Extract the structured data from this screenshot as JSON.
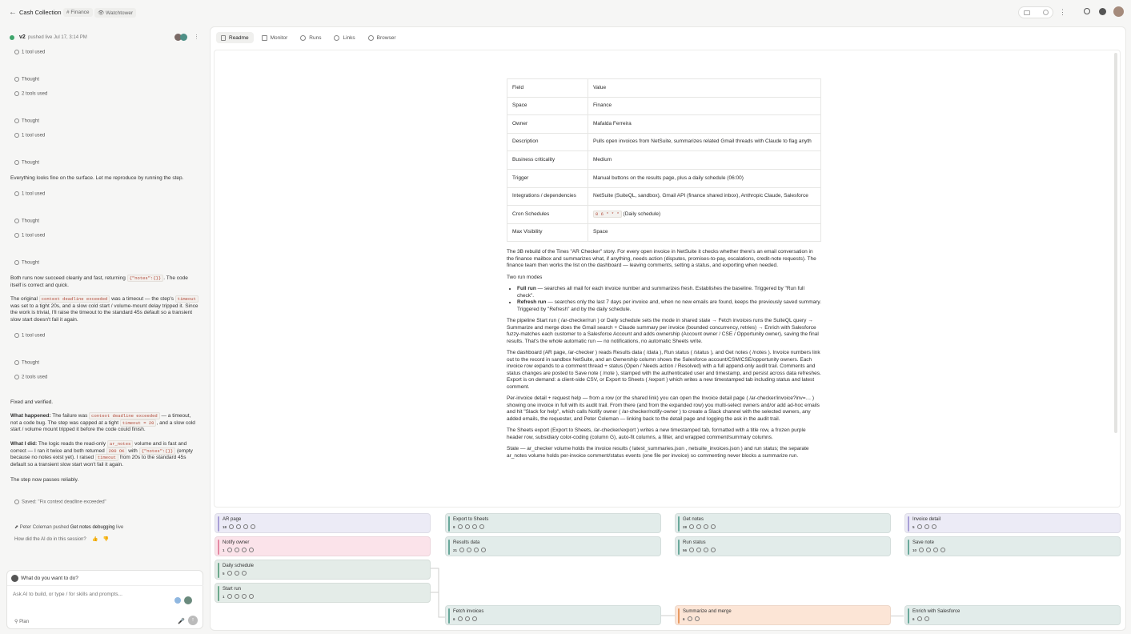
{
  "header": {
    "title": "Cash Collection",
    "tags": [
      "# Finance",
      "👁 Watchtower"
    ]
  },
  "version": {
    "label": "v2",
    "meta": "pushed live Jul 17, 3:14 PM"
  },
  "chat": {
    "tool1": "1 tool used",
    "thought1": "Thought",
    "tool2": "2 tools used",
    "thought2": "Thought",
    "tool3": "1 tool used",
    "thought3": "Thought",
    "msg1": "Everything looks fine on the surface. Let me reproduce by running the step.",
    "tool4": "1 tool used",
    "thought4": "Thought",
    "tool5": "1 tool used",
    "thought5": "Thought",
    "msg2a": "Both runs now succeed cleanly and fast, returning",
    "msg2code": "{\"notes\":{}}",
    "msg2b": ". The code itself is correct and quick.",
    "msg3a": "The original",
    "msg3code1": "context deadline exceeded",
    "msg3b": "was a timeout — the step's",
    "msg3code2": "timeout",
    "msg3c": "was set to a tight 20s, and a slow cold start / volume-mount delay tripped it. Since the work is trivial, I'll raise the timeout to the standard 45s default so a transient slow start doesn't fail it again.",
    "tool6": "1 tool used",
    "thought6": "Thought",
    "tool7": "2 tools used",
    "msg4": "Fixed and verified.",
    "wh_label": "What happened:",
    "wh_a": "The failure was",
    "wh_code": "context deadline exceeded",
    "wh_b": "— a timeout, not a code bug. The step was capped at a tight",
    "wh_code2": "timeout = 20",
    "wh_c": ", and a slow cold start / volume mount tripped it before the code could finish.",
    "wid_label": "What I did:",
    "wid_a": "The logic reads the read-only",
    "wid_code": "ar_notes",
    "wid_b": "volume and is fast and correct — I ran it twice and both returned",
    "wid_code2": "200 OK",
    "wid_c": "with",
    "wid_code3": "{\"notes\":{}}",
    "wid_d": "(empty because no notes exist yet). I raised",
    "wid_code4": "timeout",
    "wid_e": "from 20s to the standard 45s default so a transient slow start won't fail it again.",
    "msg5": "The step now passes reliably.",
    "saved": "Saved: \"Fix context deadline exceeded\"",
    "push_user": "Peter Coleman",
    "push_mid": "pushed",
    "push_target": "Get notes debugging",
    "push_tail": "live",
    "feedback": "How did the AI do in this session?"
  },
  "composer": {
    "prompt": "What do you want to do?",
    "placeholder": "Ask AI to build, or type / for skills and prompts...",
    "plan": "Plan"
  },
  "tabs": [
    "Readme",
    "Monitor",
    "Runs",
    "Links",
    "Browser"
  ],
  "readme": {
    "table_head": [
      "Field",
      "Value"
    ],
    "rows": [
      [
        "Space",
        "Finance"
      ],
      [
        "Owner",
        "Mafalda Ferreira"
      ],
      [
        "Description",
        "Pulls open invoices from NetSuite, summarizes related Gmail threads with Claude to flag anyth"
      ],
      [
        "Business criticality",
        "Medium"
      ],
      [
        "Trigger",
        "Manual buttons on the results page, plus a daily schedule (06:00)"
      ],
      [
        "Integrations / dependencies",
        "NetSuite (SuiteQL, sandbox), Gmail API (finance shared inbox), Anthropic Claude, Salesforce"
      ],
      [
        "Cron Schedules",
        "(Daily schedule)"
      ],
      [
        "Max Visibility",
        "Space"
      ]
    ],
    "cron_code": "0 6 * * *",
    "intro": "The 3B rebuild of the Tines \"AR Checker\" story. For every open invoice in NetSuite it checks whether there's an email conversation in the finance mailbox and summarizes what, if anything, needs action (disputes, promises-to-pay, escalations, credit-note requests). The finance team then works the list on the dashboard — leaving comments, setting a status, and exporting when needed.",
    "modes_title": "Two run modes",
    "mode1_b": "Full run",
    "mode1": " — searches all mail for each invoice number and summarizes fresh. Establishes the baseline. Triggered by \"Run full check\".",
    "mode2_b": "Refresh run",
    "mode2": " — searches only the last 7 days per invoice and, when no new emails are found, keeps the previously saved summary. Triggered by \"Refresh\" and by the daily schedule.",
    "p_pipeline": "The pipeline Start run ( /ar-checker/run ) or Daily schedule sets the mode in shared state → Fetch invoices runs the SuiteQL query → Summarize and merge does the Gmail search + Claude summary per invoice (bounded concurrency, retries) → Enrich with Salesforce fuzzy-matches each customer to a Salesforce Account and adds ownership (Account owner / CSE / Opportunity owner), saving the final results. That's the whole automatic run — no notifications, no automatic Sheets write.",
    "p_dashboard": "The dashboard (AR page, /ar-checker ) reads Results data ( /data ), Run status ( /status ), and Get notes ( /notes ). Invoice numbers link out to the record in sandbox NetSuite, and an Ownership column shows the Salesforce account/CSM/CSE/opportunity owners. Each invoice row expands to a comment thread + status (Open / Needs action / Resolved) with a full append-only audit trail. Comments and status changes are posted to Save note ( /note ), stamped with the authenticated user and timestamp, and persist across data refreshes. Export is on demand: a client-side CSV, or Export to Sheets ( /export ) which writes a new timestamped tab including status and latest comment.",
    "p_detail": "Per-invoice detail + request help — from a row (or the shared link) you can open the Invoice detail page ( /ar-checker/invoice?inv=… ) showing one invoice in full with its audit trail. From there (and from the expanded row) you multi-select owners and/or add ad-hoc emails and hit \"Slack for help\", which calls Notify owner ( /ar-checker/notify-owner ) to create a Slack channel with the selected owners, any added emails, the requester, and Peter Coleman — linking back to the detail page and logging the ask in the audit trail.",
    "p_sheets": "The Sheets export (Export to Sheets, /ar-checker/export ) writes a new timestamped tab, formatted with a title row, a frozen purple header row, subsidiary color-coding (column G), auto-fit columns, a filter, and wrapped comment/summary columns.",
    "p_state": "State — ar_checker volume holds the invoice results ( latest_summaries.json , netsuite_invoices.json ) and run status; the separate ar_notes volume holds per-invoice comment/status events (one file per invoice) so commenting never blocks a summarize run."
  },
  "flow": {
    "nodes": [
      {
        "label": "AR page",
        "count": "18"
      },
      {
        "label": "Notify owner",
        "count": "1"
      },
      {
        "label": "Daily schedule",
        "count": "5"
      },
      {
        "label": "Start run",
        "count": "1"
      },
      {
        "label": "Export to Sheets",
        "count": "8"
      },
      {
        "label": "Results data",
        "count": "21"
      },
      {
        "label": "Fetch invoices",
        "count": "6"
      },
      {
        "label": "Get notes",
        "count": "28"
      },
      {
        "label": "Run status",
        "count": "56"
      },
      {
        "label": "Summarize and merge",
        "count": "6"
      },
      {
        "label": "Invoice detail",
        "count": "5"
      },
      {
        "label": "Save note",
        "count": "10"
      },
      {
        "label": "Enrich with Salesforce",
        "count": "6"
      }
    ]
  },
  "colors": {
    "purple": "#a89fd6",
    "pink": "#e489a3",
    "green": "#6ea98d",
    "orange": "#e79a63"
  }
}
